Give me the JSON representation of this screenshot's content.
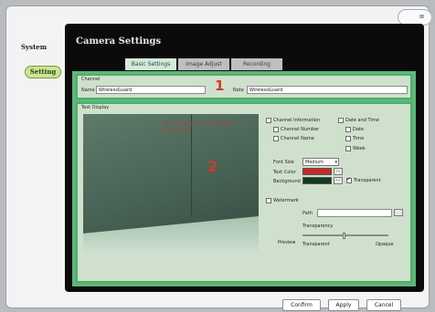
{
  "window": {
    "close_label": "⊠"
  },
  "nav": {
    "system_label": "System",
    "setting_label": "Setting"
  },
  "panel": {
    "title": "Camera Settings"
  },
  "tabs": [
    {
      "label": "Basic Settings",
      "active": true
    },
    {
      "label": "Image Adjust",
      "active": false
    },
    {
      "label": "Recording",
      "active": false
    }
  ],
  "channel": {
    "legend": "Channel",
    "name_label": "Name",
    "name_value": "WirelessGuard",
    "note_label": "Note",
    "note_value": "WirelessGuard",
    "marker": "1"
  },
  "text_display": {
    "legend": "Text Display",
    "marker": "2",
    "overlay_text": "WirelessGuard  2011/08/15  10:22:33",
    "channel_information_label": "Channel Information",
    "channel_number_label": "Channel Number",
    "channel_name_label": "Channel Name",
    "date_and_time_label": "Date and Time",
    "date_label": "Date",
    "time_label": "Time",
    "week_label": "Week",
    "font_size_label": "Font Size",
    "font_size_value": "Medium",
    "text_color_label": "Text Color",
    "text_color": "#c62a2a",
    "background_label": "Background",
    "background_color": "#0f3b22",
    "transparent_label": "Transparent",
    "transparent_checked": true,
    "watermark_label": "Watermark",
    "path_label": "Path",
    "transparency_label": "Transparency",
    "preview_label": "Preview",
    "slider_min_label": "Transparent",
    "slider_max_label": "Opaque"
  },
  "buttons": {
    "confirm": "Confirm",
    "apply": "Apply",
    "cancel": "Cancel"
  },
  "colors": {
    "accent_green": "#5db87a",
    "panel_black": "#0b0b0b",
    "marker_red": "#d23a2a"
  }
}
